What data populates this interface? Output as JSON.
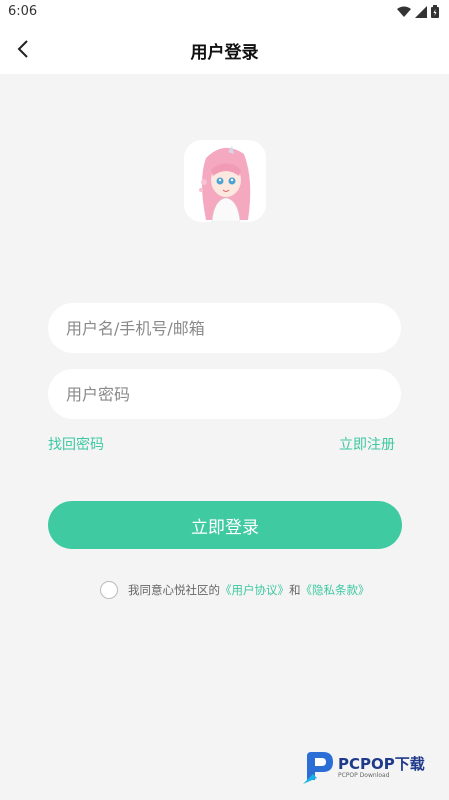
{
  "status": {
    "time": "6:06"
  },
  "header": {
    "title": "用户登录"
  },
  "form": {
    "username_placeholder": "用户名/手机号/邮箱",
    "password_placeholder": "用户密码",
    "forgot_label": "找回密码",
    "register_label": "立即注册",
    "login_label": "立即登录"
  },
  "agreement": {
    "prefix": "我同意心悦社区的",
    "user_agreement": "《用户协议》",
    "and": "和",
    "privacy_policy": "《隐私条款》"
  },
  "watermark": {
    "brand": "PCPOP下载",
    "sub": "PCPOP Download"
  },
  "colors": {
    "accent": "#3fcaa1",
    "background": "#f4f4f4"
  }
}
